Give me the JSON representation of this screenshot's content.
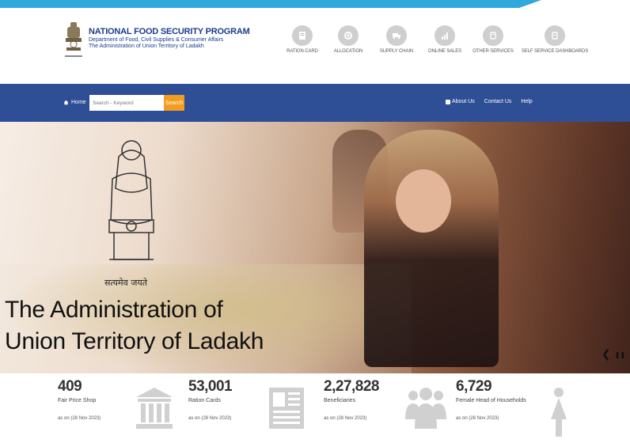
{
  "header": {
    "title": "NATIONAL FOOD SECURITY PROGRAM",
    "subtitle_1": "Department of Food, Civil Supplies & Consumer Affairs",
    "subtitle_2": "The Administration of Union Territory of Ladakh",
    "emblem_motto": "सत्यमेव जयते"
  },
  "nav_icons": [
    {
      "label": "RATION CARD",
      "icon": "ration-card-icon"
    },
    {
      "label": "ALLOCATION",
      "icon": "allocation-icon"
    },
    {
      "label": "SUPPLY CHAIN",
      "icon": "truck-icon"
    },
    {
      "label": "ONLINE SALES",
      "icon": "chart-icon"
    },
    {
      "label": "OTHER SERVICES",
      "icon": "services-icon"
    },
    {
      "label": "SELF SERVICE DASHBOARDS",
      "icon": "dashboard-icon"
    }
  ],
  "navbar": {
    "home": "Home",
    "search_placeholder": "Search - Keyword",
    "search_button": "Search",
    "about": "About Us",
    "contact": "Contact Us",
    "help": "Help"
  },
  "hero": {
    "motto": "सत्यमेव जयते",
    "title_line1": "The Administration of",
    "title_line2": "Union Territory of Ladakh",
    "prev": "❮",
    "pause": "❚❚",
    "next": "❯"
  },
  "stats": [
    {
      "value": "409",
      "label": "Fair Price Shop",
      "as_of": "as on (28 Nov 2023)",
      "icon": "bank-icon"
    },
    {
      "value": "53,001",
      "label": "Ration Cards",
      "as_of": "as on (28 Nov 2023)",
      "icon": "newspaper-icon"
    },
    {
      "value": "2,27,828",
      "label": "Beneficiaries",
      "as_of": "as on (28 Nov 2023)",
      "icon": "group-icon"
    },
    {
      "value": "6,729",
      "label": "Female Head of Households",
      "as_of": "as on (28 Nov 2023)",
      "icon": "female-icon"
    }
  ],
  "colors": {
    "accent_strip": "#2fa8dc",
    "navbar": "#2e4e95",
    "search_button": "#f39c1f",
    "brand_text": "#1b3c8d"
  }
}
